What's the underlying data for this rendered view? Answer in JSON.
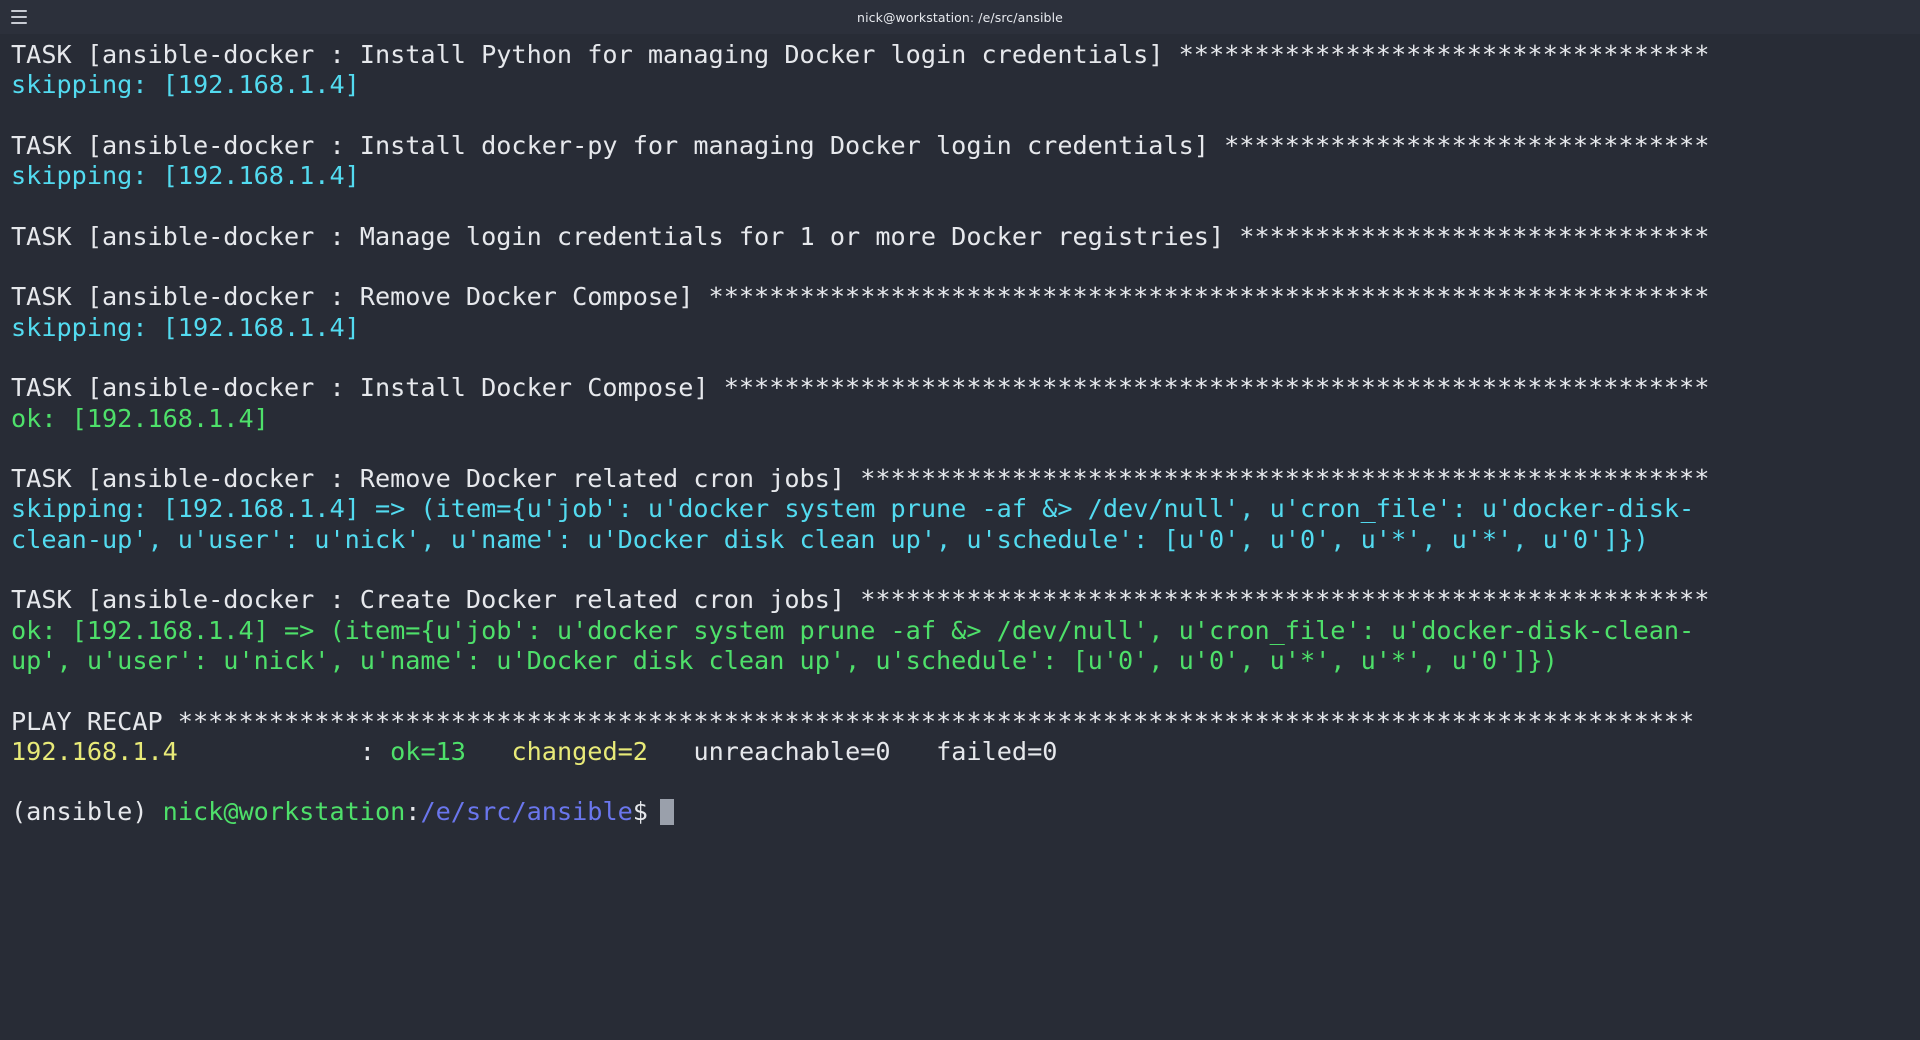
{
  "window": {
    "title": "nick@workstation: /e/src/ansible",
    "menu_icon": "hamburger-icon",
    "background": "#282c36"
  },
  "colors": {
    "default": "#e6e8ec",
    "cyan": "#53dbf0",
    "green": "#4ee06a",
    "yellow": "#e8ea78",
    "blue": "#6a76ed",
    "background": "#282c36",
    "titlebar": "#2c303b",
    "cursor": "#9aa0ab"
  },
  "terminal": {
    "lines": [
      {
        "id": "l1",
        "color": "default",
        "text": "TASK [ansible-docker : Install Python for managing Docker login credentials] ***********************************"
      },
      {
        "id": "l2",
        "color": "cyan",
        "text": "skipping: [192.168.1.4]"
      },
      {
        "id": "l3",
        "color": "default",
        "text": ""
      },
      {
        "id": "l4",
        "color": "default",
        "text": "TASK [ansible-docker : Install docker-py for managing Docker login credentials] ********************************"
      },
      {
        "id": "l5",
        "color": "cyan",
        "text": "skipping: [192.168.1.4]"
      },
      {
        "id": "l6",
        "color": "default",
        "text": ""
      },
      {
        "id": "l7",
        "color": "default",
        "text": "TASK [ansible-docker : Manage login credentials for 1 or more Docker registries] *******************************"
      },
      {
        "id": "l8",
        "color": "default",
        "text": ""
      },
      {
        "id": "l9",
        "color": "default",
        "text": "TASK [ansible-docker : Remove Docker Compose] ******************************************************************"
      },
      {
        "id": "l10",
        "color": "cyan",
        "text": "skipping: [192.168.1.4]"
      },
      {
        "id": "l11",
        "color": "default",
        "text": ""
      },
      {
        "id": "l12",
        "color": "default",
        "text": "TASK [ansible-docker : Install Docker Compose] *****************************************************************"
      },
      {
        "id": "l13",
        "color": "green",
        "text": "ok: [192.168.1.4]"
      },
      {
        "id": "l14",
        "color": "default",
        "text": ""
      },
      {
        "id": "l15",
        "color": "default",
        "text": "TASK [ansible-docker : Remove Docker related cron jobs] ********************************************************"
      },
      {
        "id": "l16",
        "color": "cyan",
        "text": "skipping: [192.168.1.4] => (item={u'job': u'docker system prune -af &> /dev/null', u'cron_file': u'docker-disk-"
      },
      {
        "id": "l17",
        "color": "cyan",
        "text": "clean-up', u'user': u'nick', u'name': u'Docker disk clean up', u'schedule': [u'0', u'0', u'*', u'*', u'0']})"
      },
      {
        "id": "l18",
        "color": "default",
        "text": ""
      },
      {
        "id": "l19",
        "color": "default",
        "text": "TASK [ansible-docker : Create Docker related cron jobs] ********************************************************"
      },
      {
        "id": "l20",
        "color": "green",
        "text": "ok: [192.168.1.4] => (item={u'job': u'docker system prune -af &> /dev/null', u'cron_file': u'docker-disk-clean-"
      },
      {
        "id": "l21",
        "color": "green",
        "text": "up', u'user': u'nick', u'name': u'Docker disk clean up', u'schedule': [u'0', u'0', u'*', u'*', u'0']})"
      },
      {
        "id": "l22",
        "color": "default",
        "text": ""
      },
      {
        "id": "l23",
        "color": "default",
        "text": "PLAY RECAP ****************************************************************************************************"
      }
    ],
    "recap": {
      "host": "192.168.1.4",
      "host_pad": "            ",
      "separator": ": ",
      "ok_label": "ok=13",
      "gap1": "   ",
      "changed_label": "changed=2",
      "gap2": "   ",
      "unreachable_label": "unreachable=0",
      "gap3": "   ",
      "failed_label": "failed=0"
    },
    "prompt": {
      "venv": "(ansible)",
      "space1": " ",
      "user_host": "nick@workstation",
      "colon": ":",
      "path": "/e/src/ansible",
      "dollar": "$",
      "input": "",
      "cursor": "block"
    }
  }
}
